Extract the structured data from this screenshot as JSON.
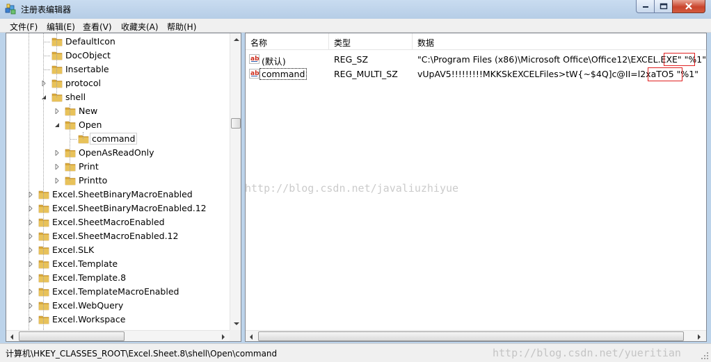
{
  "window": {
    "title": "注册表编辑器",
    "min_icon": "minimize-icon",
    "max_icon": "maximize-icon",
    "close_icon": "close-icon"
  },
  "menu": [
    "文件(F)",
    "编辑(E)",
    "查看(V)",
    "收藏夹(A)",
    "帮助(H)"
  ],
  "tree": {
    "items": [
      {
        "label": "DefaultIcon",
        "level": 3,
        "expander": "none"
      },
      {
        "label": "DocObject",
        "level": 3,
        "expander": "none"
      },
      {
        "label": "Insertable",
        "level": 3,
        "expander": "none"
      },
      {
        "label": "protocol",
        "level": 3,
        "expander": "collapsed"
      },
      {
        "label": "shell",
        "level": 3,
        "expander": "expanded"
      },
      {
        "label": "New",
        "level": 4,
        "expander": "collapsed"
      },
      {
        "label": "Open",
        "level": 4,
        "expander": "expanded"
      },
      {
        "label": "command",
        "level": 5,
        "expander": "none",
        "selected": true
      },
      {
        "label": "OpenAsReadOnly",
        "level": 4,
        "expander": "collapsed"
      },
      {
        "label": "Print",
        "level": 4,
        "expander": "collapsed"
      },
      {
        "label": "Printto",
        "level": 4,
        "expander": "collapsed"
      },
      {
        "label": "Excel.SheetBinaryMacroEnabled",
        "level": 2,
        "expander": "collapsed"
      },
      {
        "label": "Excel.SheetBinaryMacroEnabled.12",
        "level": 2,
        "expander": "collapsed"
      },
      {
        "label": "Excel.SheetMacroEnabled",
        "level": 2,
        "expander": "collapsed"
      },
      {
        "label": "Excel.SheetMacroEnabled.12",
        "level": 2,
        "expander": "collapsed"
      },
      {
        "label": "Excel.SLK",
        "level": 2,
        "expander": "collapsed"
      },
      {
        "label": "Excel.Template",
        "level": 2,
        "expander": "collapsed"
      },
      {
        "label": "Excel.Template.8",
        "level": 2,
        "expander": "collapsed"
      },
      {
        "label": "Excel.TemplateMacroEnabled",
        "level": 2,
        "expander": "collapsed"
      },
      {
        "label": "Excel.WebQuery",
        "level": 2,
        "expander": "collapsed"
      },
      {
        "label": "Excel.Workspace",
        "level": 2,
        "expander": "collapsed"
      }
    ]
  },
  "list": {
    "columns": [
      "名称",
      "类型",
      "数据"
    ],
    "rows": [
      {
        "name": "(默认)",
        "type": "REG_SZ",
        "data": "\"C:\\Program Files (x86)\\Microsoft Office\\Office12\\EXCEL.EXE\" \"%1\"",
        "icon": "string-value-icon"
      },
      {
        "name": "command",
        "type": "REG_MULTI_SZ",
        "data": "vUpAV5!!!!!!!!!MKKSkEXCELFiles>tW{~$4Q]c@II=l2xaTO5 \"%1\"",
        "icon": "string-value-icon"
      }
    ]
  },
  "status": "计算机\\HKEY_CLASSES_ROOT\\Excel.Sheet.8\\shell\\Open\\command",
  "watermarks": [
    "http://blog.csdn.net/javaliuzhiyue",
    "http://blog.csdn.net/yueritian"
  ],
  "colors": {
    "folder": "#e8c25a",
    "highlight_box": "#e02020",
    "titlebar": "#c9dcf0"
  }
}
